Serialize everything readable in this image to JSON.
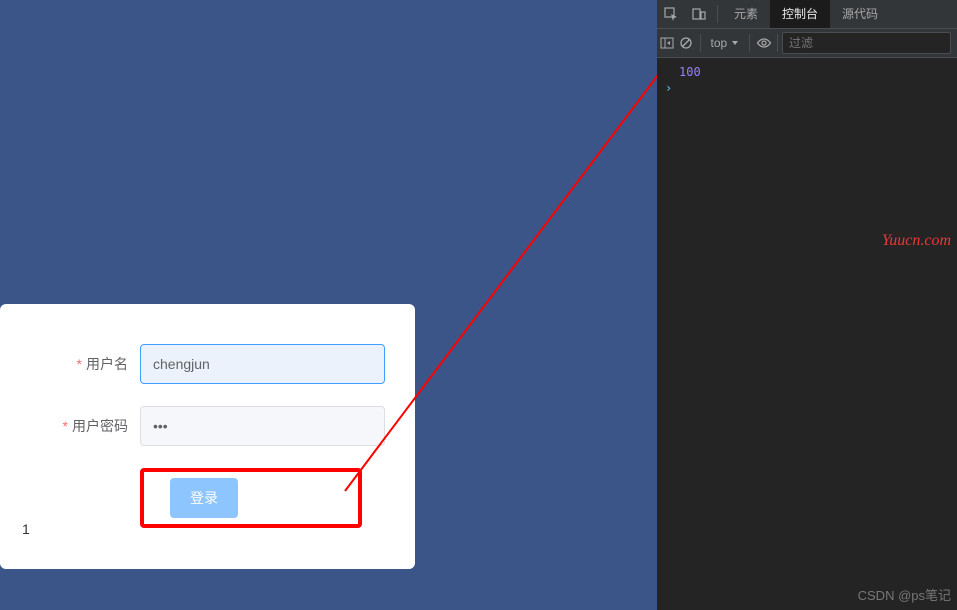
{
  "form": {
    "username_label": "用户名",
    "username_value": "chengjun",
    "password_label": "用户密码",
    "password_value": "•••",
    "login_label": "登录",
    "counter": "1"
  },
  "devtools": {
    "tabs": {
      "elements": "元素",
      "console": "控制台",
      "sources": "源代码"
    },
    "context": "top",
    "filter_placeholder": "过滤",
    "console_output": "100"
  },
  "watermarks": {
    "site": "Yuucn.com",
    "attribution": "CSDN @ps笔记"
  }
}
